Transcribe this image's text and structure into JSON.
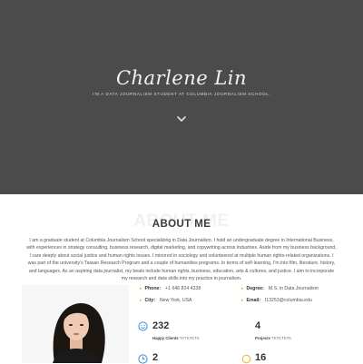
{
  "hero": {
    "name": "Charlene Lin",
    "tagline": "I'M A DATA JOURNALISM STUDENT AT COLUMBIA JOURNALISM SCHOOL.",
    "scroll_icon": "chevron-down-icon",
    "background": "#4b4b4b"
  },
  "about": {
    "ghost_title": "ABOUT ME",
    "title": "ABOUT ME",
    "bio": "I am a graduate student at Columbia Journalism School specializing in Data Journalism. I hold an undergraduate degree in International Business, with experiences in strategy consulting, business research, digital marketing, and copywriting across industries. Aside from my business background, I care deeply about social justice and human rights issues. I minored in sociology and volunteered at multiple human rights-related organizations. I was part of the university's Taiwan Research Program and a couple of humanities programs. In terms of self-learning, I'm into film, literature, history, and languages. As an aspiring data journalist, my beats include human rights, business, education, arts & cultures, and justice. I aim to incorporate my research and data skills into my practice in journalism.",
    "info": {
      "phone_label": "Phone:",
      "phone": "+1 646 824 4338",
      "city_label": "City:",
      "city": "New York, USA",
      "degree_label": "Degree:",
      "degree": "M.S. in Data Journalism",
      "email_label": "Email:",
      "email": "l13253@columbia.edu"
    },
    "stats": [
      {
        "value": "232",
        "label": "Happy Clients",
        "suffix": "TKTKTKTK",
        "icon": "smile-icon"
      },
      {
        "value": "4",
        "label": "Projects",
        "suffix": "TKTKTKTK",
        "icon": ""
      },
      {
        "value": "2",
        "label": "",
        "suffix": "",
        "icon": "clock-icon"
      },
      {
        "value": "16",
        "label": "",
        "suffix": "",
        "icon": "award-icon"
      }
    ],
    "accent_blue": "#3b8fd9",
    "accent_yellow": "#f0b429"
  }
}
